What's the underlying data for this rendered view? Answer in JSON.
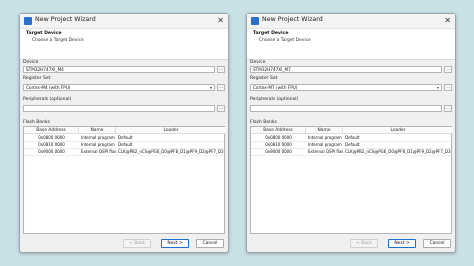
{
  "windows": [
    {
      "title": "New Project Wizard",
      "header_title": "Target Device",
      "header_subtitle": "Choose a Target Device",
      "device_label": "Device",
      "device_value": "STM32H747XI_M4",
      "register_label": "Register Set",
      "register_value": "Cortex-M4 (with FPU)",
      "peripherals_label": "Peripherals (optional)",
      "peripherals_value": "",
      "flash_label": "Flash Banks",
      "columns": [
        "Base Address",
        "Name",
        "Loader"
      ],
      "rows": [
        [
          "0x0800 0000",
          "Internal program flash",
          "Default"
        ],
        [
          "0x0810 0000",
          "Internal program flash",
          "Default"
        ],
        [
          "0x9000 0000",
          "External QSPI flash",
          "CLK@PB2_nCS@PG6_D0@PF8_D1@PF9_D2@PF7_D3"
        ]
      ],
      "buttons": {
        "back": "< Back",
        "next": "Next >",
        "cancel": "Cancel"
      },
      "dots": "...",
      "close": "✕"
    },
    {
      "title": "New Project Wizard",
      "header_title": "Target Device",
      "header_subtitle": "Choose a Target Device",
      "device_label": "Device",
      "device_value": "STM32H747XI_M7",
      "register_label": "Register Set",
      "register_value": "Cortex-M7 (with FPU)",
      "peripherals_label": "Peripherals (optional)",
      "peripherals_value": "",
      "flash_label": "Flash Banks",
      "columns": [
        "Base Address",
        "Name",
        "Loader"
      ],
      "rows": [
        [
          "0x0800 0000",
          "Internal program flash",
          "Default"
        ],
        [
          "0x0810 0000",
          "Internal program flash",
          "Default"
        ],
        [
          "0x9000 0000",
          "External QSPI flash",
          "CLK@PB2_nCS@PG6_D0@PF8_D1@PF9_D2@PF7_D3"
        ]
      ],
      "buttons": {
        "back": "< Back",
        "next": "Next >",
        "cancel": "Cancel"
      },
      "dots": "...",
      "close": "✕"
    }
  ],
  "colors": {
    "background": "#c9e0e7",
    "accent": "#1a6fd0"
  }
}
